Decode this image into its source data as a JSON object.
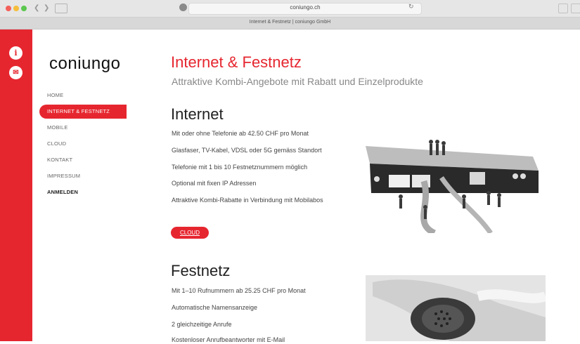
{
  "browser": {
    "url": "coniungo.ch",
    "tab_title": "Internet & Festnetz | coniungo GmbH"
  },
  "brand": {
    "logo": "coniungo",
    "accent_color": "#e6262f"
  },
  "side_icons": {
    "info": "i",
    "mail": "✉"
  },
  "nav": {
    "items": [
      {
        "label": "HOME"
      },
      {
        "label": "INTERNET & FESTNETZ"
      },
      {
        "label": "MOBILE"
      },
      {
        "label": "CLOUD"
      },
      {
        "label": "KONTAKT"
      },
      {
        "label": "IMPRESSUM"
      },
      {
        "label": "ANMELDEN"
      }
    ],
    "active_index": 1
  },
  "page": {
    "title": "Internet & Festnetz",
    "subtitle": "Attraktive Kombi-Angebote mit Rabatt und Einzelprodukte"
  },
  "internet": {
    "title": "Internet",
    "lines": [
      "Mit oder ohne Telefonie ab 42.50 CHF pro Monat",
      "Glasfaser, TV-Kabel, VDSL oder 5G gemäss Standort",
      "Telefonie mit 1 bis 10 Festnetznummern möglich",
      "Optional mit fixen IP Adressen",
      "Attraktive Kombi-Rabatte in Verbindung mit Mobilabos"
    ],
    "button": "CLOUD",
    "image_alt": "router-with-miniature-figures"
  },
  "festnetz": {
    "title": "Festnetz",
    "lines": [
      "Mit 1–10 Rufnummern ab 25.25 CHF pro Monat",
      "Automatische Namensanzeige",
      "2 gleichzeitige Anrufe",
      "Kostenloser Anrufbeantworter mit E-Mail"
    ],
    "image_alt": "telephone-handset"
  }
}
